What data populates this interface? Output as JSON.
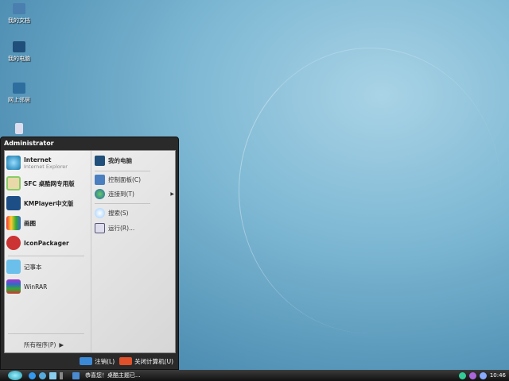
{
  "desktop": {
    "icons": [
      {
        "label": "我的文档"
      },
      {
        "label": "我的电脑"
      },
      {
        "label": "网上邻居"
      },
      {
        "label": ""
      }
    ]
  },
  "start_menu": {
    "user": "Administrator",
    "pinned": [
      {
        "label": "Internet",
        "sub": "Internet Explorer"
      },
      {
        "label": "SFC 桌酷网专用版"
      },
      {
        "label": "KMPlayer中文版"
      },
      {
        "label": "画图"
      },
      {
        "label": "IconPackager"
      }
    ],
    "recent": [
      {
        "label": "记事本"
      },
      {
        "label": "WinRAR"
      }
    ],
    "all_programs": "所有程序(P)",
    "right": [
      {
        "label": "我的电脑"
      },
      {
        "label": "控制面板(C)"
      },
      {
        "label": "连接到(T)"
      },
      {
        "label": "搜索(S)"
      },
      {
        "label": "运行(R)..."
      }
    ],
    "logoff": "注销(L)",
    "shutdown": "关闭计算机(U)"
  },
  "taskbar": {
    "task": "恭喜您！桌酷主题已...",
    "clock": "10:46"
  }
}
